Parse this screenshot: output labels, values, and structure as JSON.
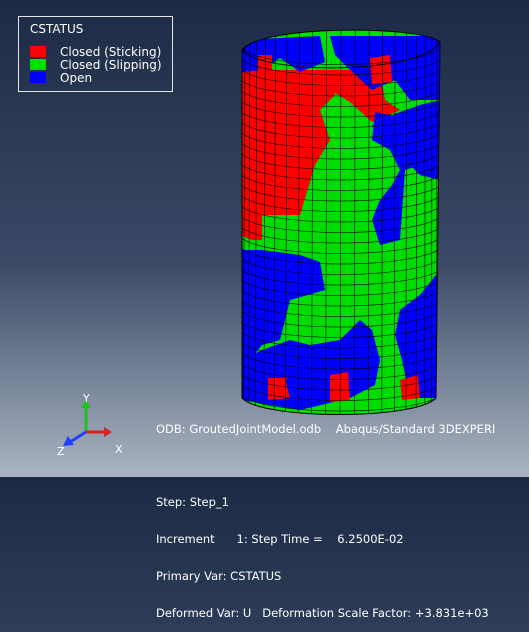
{
  "legend": {
    "title": "CSTATUS",
    "items": [
      {
        "label": "Closed (Sticking)",
        "color": "#ff0000"
      },
      {
        "label": "Closed (Slipping)",
        "color": "#00dd00"
      },
      {
        "label": "Open",
        "color": "#0000ff"
      }
    ]
  },
  "info": {
    "odb": "ODB: GroutedJointModel.odb    Abaqus/Standard 3DEXPERI",
    "blank": "",
    "step": "Step: Step_1",
    "increment": "Increment      1: Step Time =    6.2500E-02",
    "primary": "Primary Var: CSTATUS",
    "deformed": "Deformed Var: U   Deformation Scale Factor: +3.831e+03"
  },
  "triad": {
    "x": "X",
    "y": "Y",
    "z": "Z"
  },
  "colors": {
    "mesh": "#000000",
    "triad_x": "#e02020",
    "triad_y": "#20c020",
    "triad_z": "#2040ff"
  }
}
